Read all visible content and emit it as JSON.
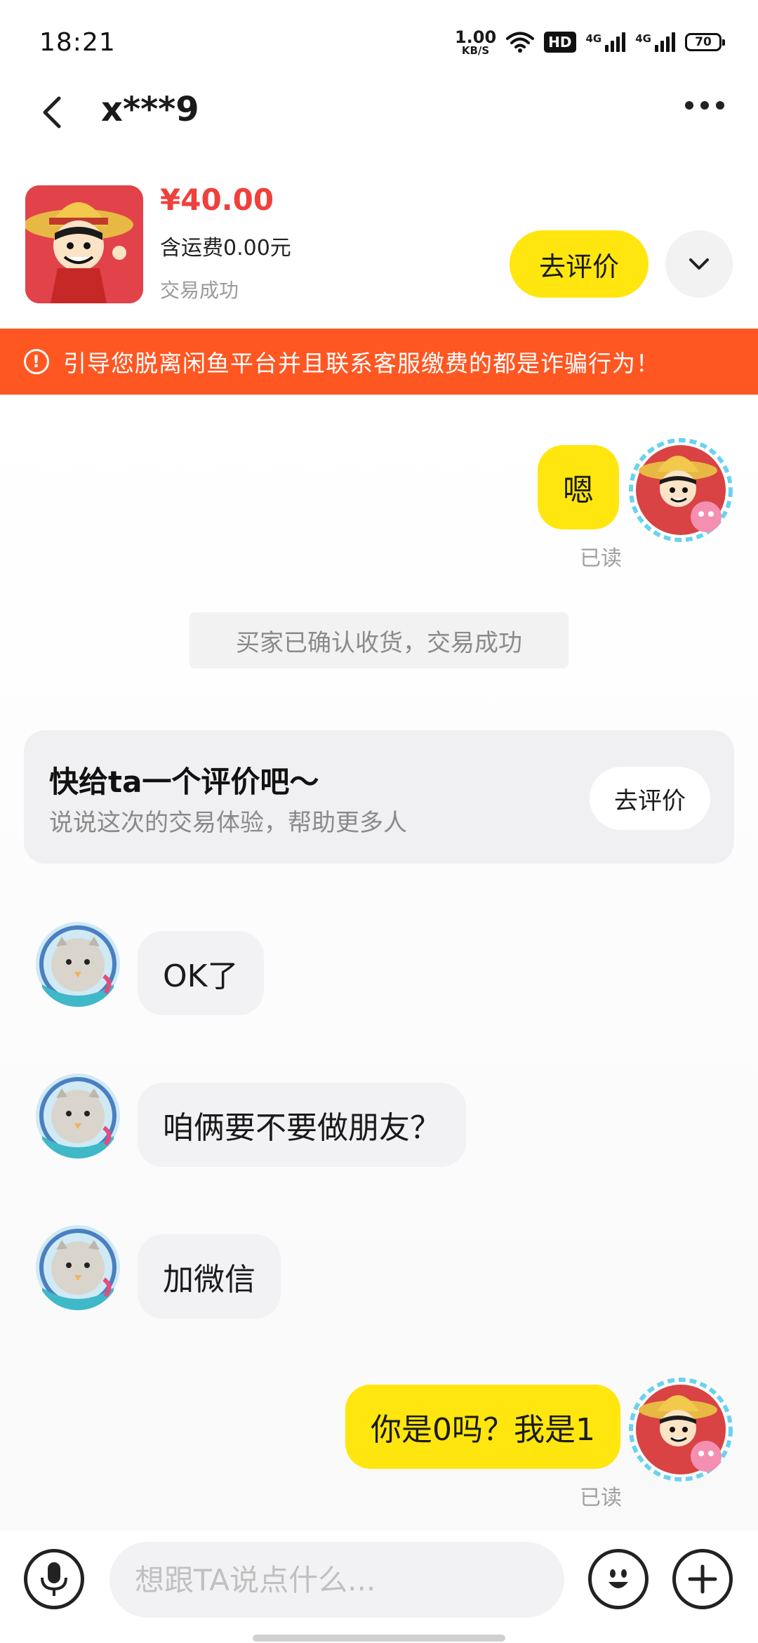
{
  "status_bar": {
    "time": "18:21",
    "net_speed_value": "1.00",
    "net_speed_unit": "KB/S",
    "hd_label": "HD",
    "signal1_label": "4G",
    "signal2_label": "4G",
    "battery": "70"
  },
  "nav": {
    "title": "x***9",
    "back_icon": "chevron-left-icon",
    "more_icon": "more-dots-icon"
  },
  "product": {
    "price": "¥40.00",
    "shipping": "含运费0.00元",
    "status": "交易成功",
    "review_button": "去评价"
  },
  "warning": {
    "text": "引导您脱离闲鱼平台并且联系客服缴费的都是诈骗行为！"
  },
  "chat": {
    "messages": [
      {
        "from": "me",
        "text": "嗯",
        "read": "已读"
      },
      {
        "from": "system",
        "text": "买家已确认收货，交易成功"
      },
      {
        "from": "review_card",
        "title": "快给ta一个评价吧～",
        "subtitle": "说说这次的交易体验，帮助更多人",
        "button": "去评价"
      },
      {
        "from": "other",
        "text": "OK了"
      },
      {
        "from": "other",
        "text": "咱俩要不要做朋友？"
      },
      {
        "from": "other",
        "text": "加微信"
      },
      {
        "from": "me",
        "text": "你是0吗？我是1",
        "read": "已读"
      }
    ]
  },
  "input_bar": {
    "placeholder": "想跟TA说点什么...",
    "voice_icon": "microphone-icon",
    "emoji_icon": "emoji-icon",
    "plus_icon": "plus-icon"
  },
  "colors": {
    "accent_yellow": "#ffe60f",
    "price_red": "#f0403c",
    "warning_orange": "#ff5722",
    "bubble_gray": "#f2f2f4"
  }
}
